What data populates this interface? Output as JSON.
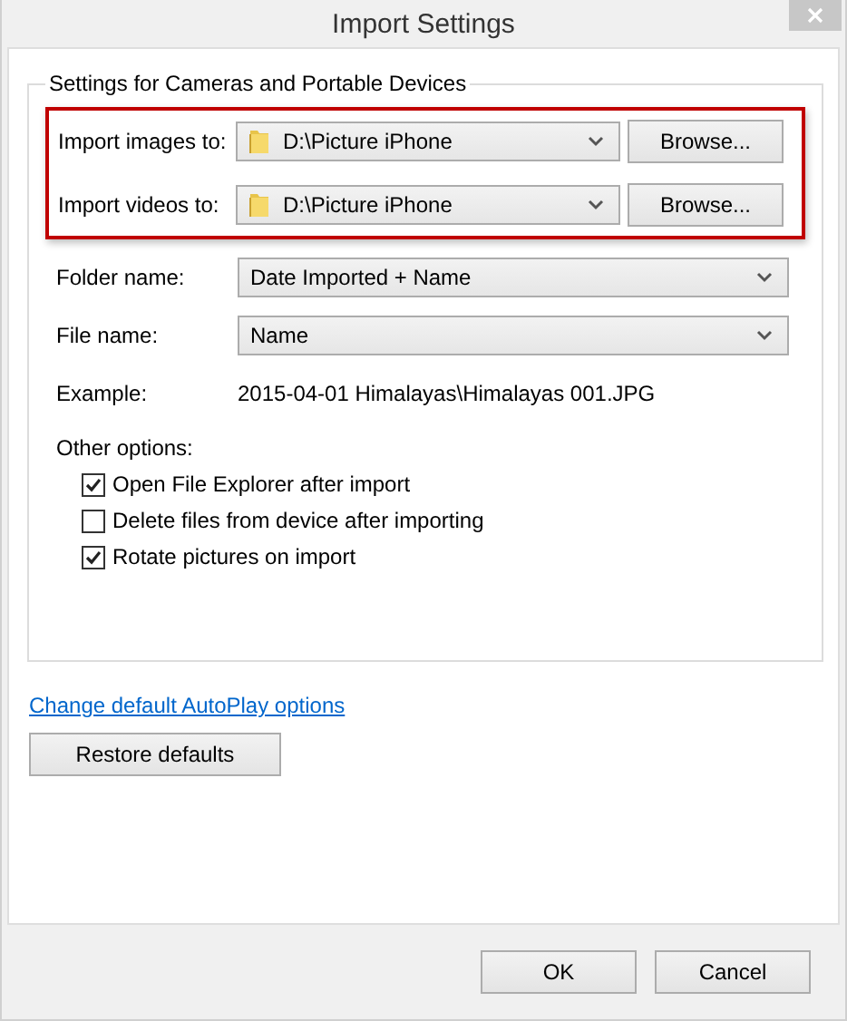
{
  "window": {
    "title": "Import Settings"
  },
  "group": {
    "title": "Settings for Cameras and Portable Devices",
    "destinations": {
      "highlighted": true,
      "rows": [
        {
          "label": "Import images to:",
          "value": "D:\\Picture iPhone",
          "button": "Browse..."
        },
        {
          "label": "Import videos to:",
          "value": "D:\\Picture iPhone",
          "button": "Browse..."
        }
      ]
    },
    "folder_name": {
      "label": "Folder name:",
      "value": "Date Imported + Name"
    },
    "file_name": {
      "label": "File name:",
      "value": "Name"
    },
    "example": {
      "label": "Example:",
      "value": "2015-04-01 Himalayas\\Himalayas 001.JPG"
    },
    "other_options": {
      "label": "Other options:",
      "options": [
        {
          "label": "Open File Explorer after import",
          "checked": true
        },
        {
          "label": "Delete files from device after importing",
          "checked": false
        },
        {
          "label": "Rotate pictures on import",
          "checked": true
        }
      ]
    }
  },
  "link": "Change default AutoPlay options",
  "restore_button": "Restore defaults",
  "buttons": [
    "OK",
    "Cancel"
  ]
}
